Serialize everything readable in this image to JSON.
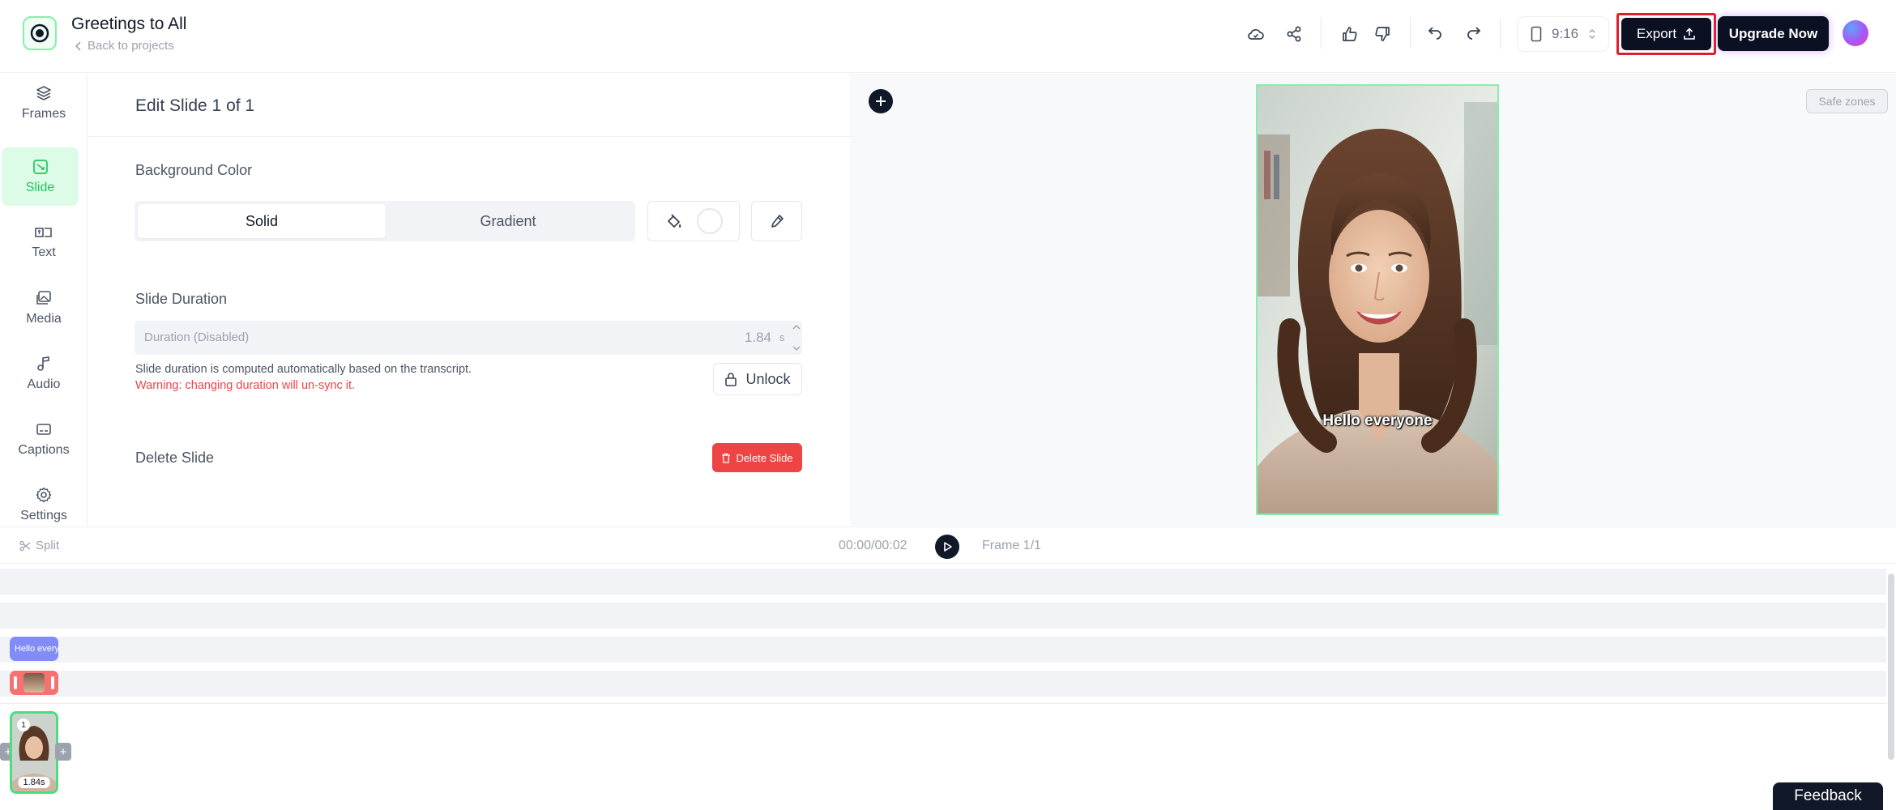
{
  "header": {
    "project_title": "Greetings to All",
    "back_label": "Back to projects",
    "aspect_ratio": "9:16",
    "export_label": "Export",
    "upgrade_label": "Upgrade Now",
    "icons": [
      "cloud-sync-icon",
      "share-icon",
      "thumbs-up-icon",
      "thumbs-down-icon",
      "undo-icon",
      "redo-icon",
      "phone-icon",
      "export-upload-icon"
    ]
  },
  "sidebar": {
    "items": [
      {
        "label": "Frames",
        "icon": "layers-icon"
      },
      {
        "label": "Slide",
        "icon": "slide-icon",
        "active": true
      },
      {
        "label": "Text",
        "icon": "text-icon"
      },
      {
        "label": "Media",
        "icon": "media-icon"
      },
      {
        "label": "Audio",
        "icon": "music-icon"
      },
      {
        "label": "Captions",
        "icon": "captions-icon"
      },
      {
        "label": "Settings",
        "icon": "gear-icon"
      }
    ]
  },
  "edit_panel": {
    "title": "Edit Slide 1 of 1",
    "bg_color_label": "Background Color",
    "solid_label": "Solid",
    "gradient_label": "Gradient",
    "selected_fill": "Solid",
    "swatch_color": "#ffffff",
    "duration_label": "Slide Duration",
    "duration_placeholder": "Duration (Disabled)",
    "duration_value": "1.84",
    "duration_unit": "s",
    "duration_note": "Slide duration is computed automatically based on the transcript.",
    "duration_warning": "Warning: changing duration will un-sync it.",
    "unlock_label": "Unlock",
    "delete_section_label": "Delete Slide",
    "delete_button_label": "Delete Slide"
  },
  "preview": {
    "safe_zones_label": "Safe zones",
    "caption_text": "Hello everyone"
  },
  "timeline": {
    "split_label": "Split",
    "time_display": "00:00/00:02",
    "frame_label": "Frame 1/1",
    "caption_clip_text": "Hello everyone",
    "slide_number": "1",
    "slide_duration": "1.84s"
  },
  "feedback_label": "Feedback",
  "colors": {
    "accent_green": "#22c55e",
    "active_bg": "#dcfce7",
    "danger": "#ef4444",
    "dark": "#0b1023",
    "export_highlight": "#e11d2a",
    "caption_clip": "#818cf8",
    "video_clip": "#f87171"
  }
}
